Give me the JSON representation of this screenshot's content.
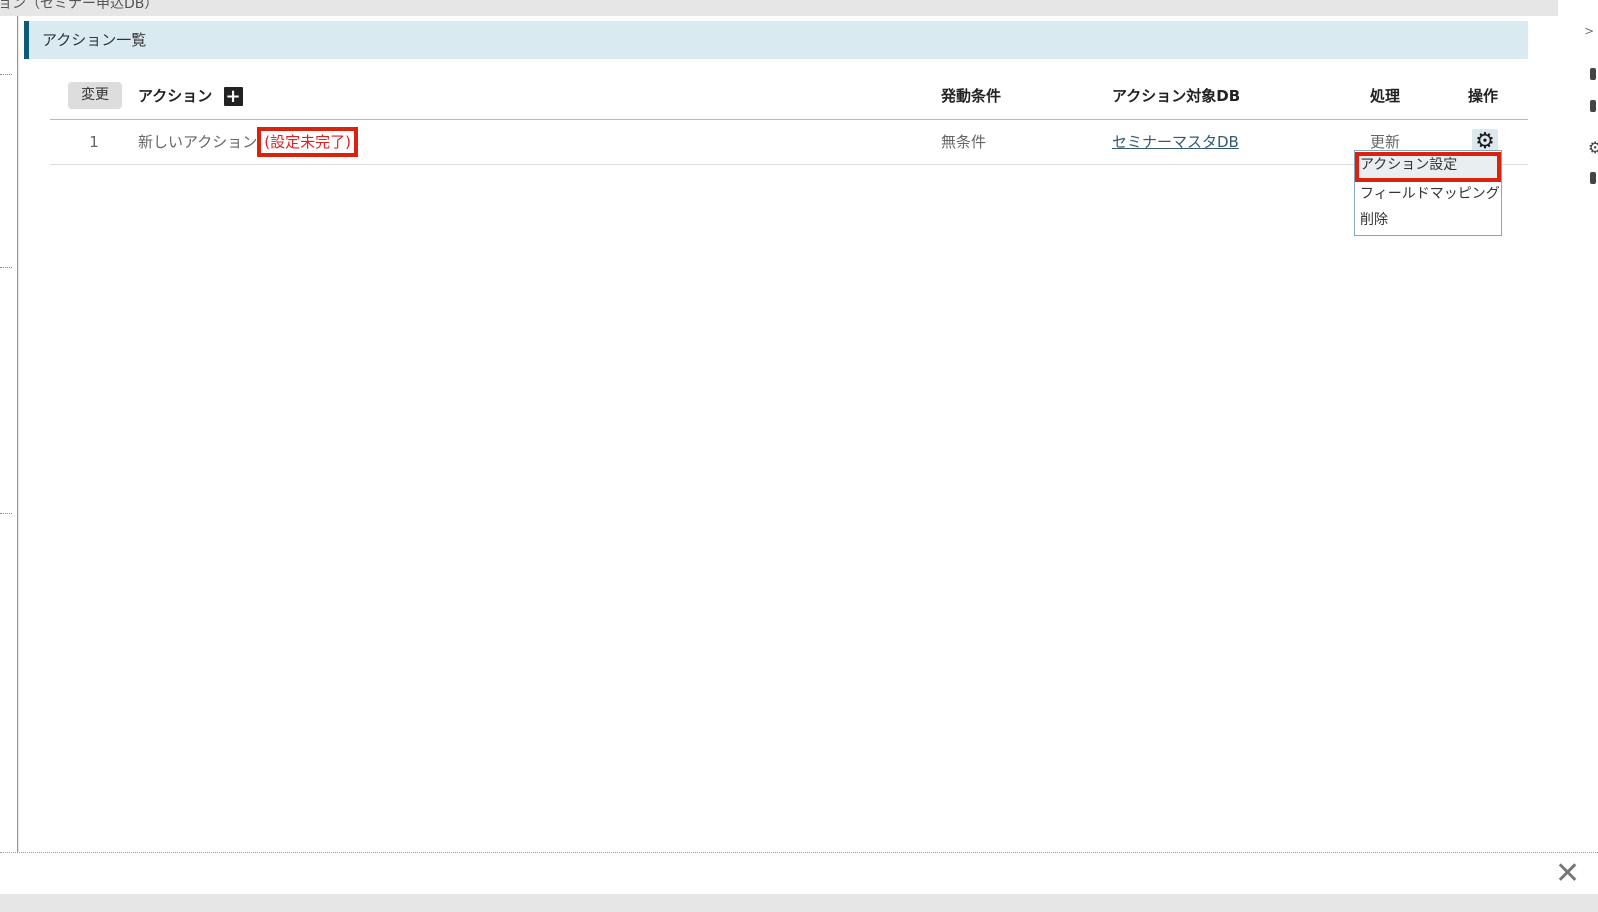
{
  "window": {
    "partial_title": "ョン（セミナー申込DB）"
  },
  "section": {
    "title": "アクション一覧"
  },
  "table": {
    "change_label": "変更",
    "headers": {
      "action": "アクション",
      "condition": "発動条件",
      "target_db": "アクション対象DB",
      "process": "処理",
      "operation": "操作"
    },
    "rows": [
      {
        "num": "1",
        "action_name": "新しいアクション",
        "status": "(設定未完了)",
        "condition": "無条件",
        "target_db": "セミナーマスタDB",
        "process": "更新"
      }
    ]
  },
  "dropdown": {
    "items": [
      "アクション設定",
      "フィールドマッピング",
      "削除"
    ]
  },
  "icons": {
    "add": "plus-icon",
    "settings": "gear-icon",
    "close": "close-icon"
  },
  "colors": {
    "accent_header_bar": "#0e5b78",
    "header_bg": "#daeaf1",
    "status_red": "#e02020",
    "highlight_border": "#d9230f"
  }
}
